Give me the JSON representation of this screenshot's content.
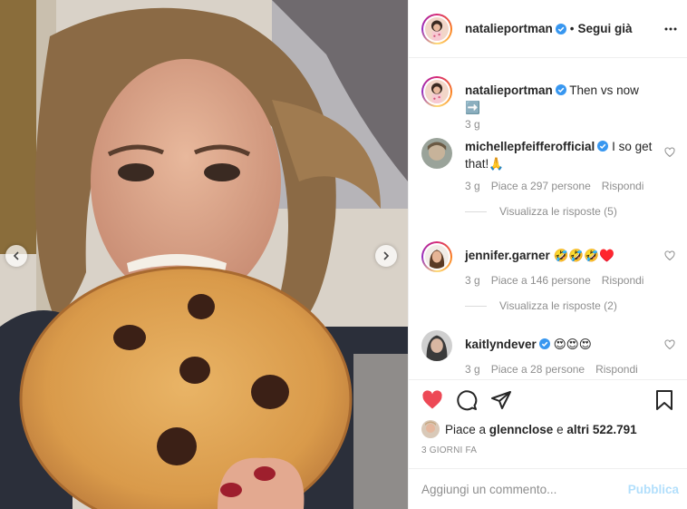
{
  "post": {
    "author": "natalieportman",
    "follow_state": "Segui già",
    "caption_author": "natalieportman",
    "caption_text": "Then vs now ➡️",
    "caption_time": "3 g"
  },
  "comments": [
    {
      "user": "michellepfeifferofficial",
      "text": "I so get that!🙏",
      "time": "3 g",
      "likes": "Piace a 297 persone",
      "reply": "Rispondi",
      "view_replies": "Visualizza le risposte (5)"
    },
    {
      "user": "jennifer.garner",
      "text": "🤣🤣🤣♥️",
      "time": "3 g",
      "likes": "Piace a 146 persone",
      "reply": "Rispondi",
      "view_replies": "Visualizza le risposte (2)"
    },
    {
      "user": "kaitlyndever",
      "text": "😍😍😍",
      "time": "3 g",
      "likes": "Piace a 28 persone",
      "reply": "Rispondi"
    }
  ],
  "likes": {
    "prefix": "Piace a",
    "user": "glennclose",
    "conj": "e",
    "others": "altri 522.791"
  },
  "date": "3 GIORNI FA",
  "add_comment": {
    "placeholder": "Aggiungi un commento...",
    "publish": "Pubblica"
  },
  "colors": {
    "like_red": "#ed4956",
    "verified_blue": "#3897f0",
    "publish_disabled": "#b2dffc",
    "meta_gray": "#8e8e8e"
  },
  "icons": [
    "chevron-left-icon",
    "chevron-right-icon",
    "more-icon",
    "verified-icon",
    "heart-icon",
    "comment-icon",
    "share-icon",
    "bookmark-icon"
  ]
}
